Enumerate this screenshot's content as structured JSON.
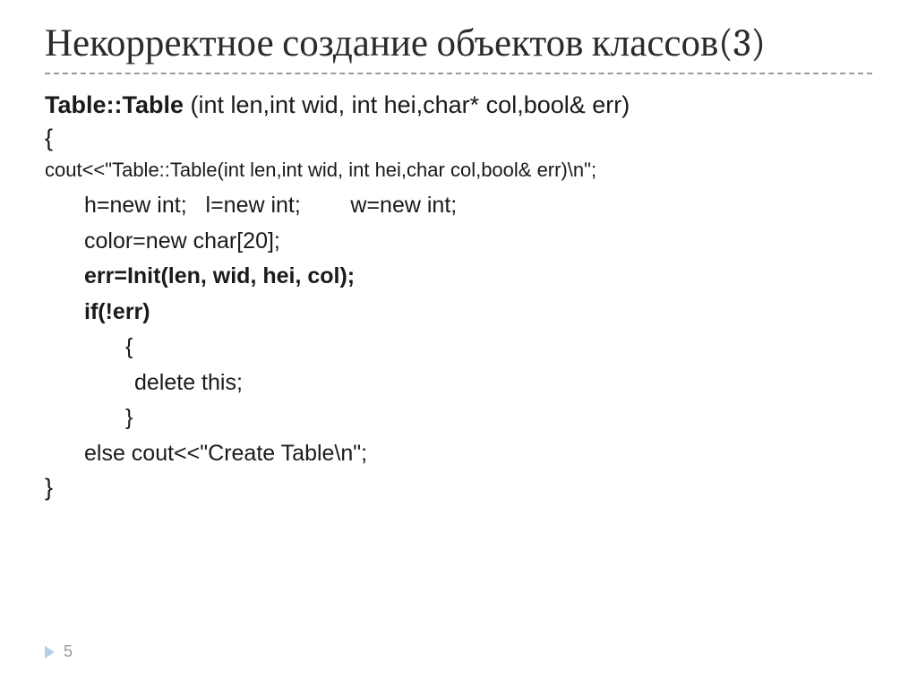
{
  "heading": "Некорректное создание объектов классов(3)",
  "signature": {
    "bold": "Table::Table",
    "rest": " (int len,int wid, int hei,char* col,bool& err)"
  },
  "open_brace": "{",
  "cout_line": "cout<<\"Table::Table(int len,int wid, int hei,char col,bool& err)\\n\";",
  "alloc_line_parts": {
    "a": "h=new int;",
    "b": "l=new int;",
    "c": "w=new int;"
  },
  "color_line": "color=new char[20];",
  "err_line": "err=Init(len, wid, hei, col);",
  "if_line": "if(!err)",
  "brace_open2": "{",
  "delete_line": "delete this;",
  "brace_close2": "}",
  "else_line": "else cout<<\"Create Table\\n\";",
  "close_brace": "}",
  "page_number": "5"
}
